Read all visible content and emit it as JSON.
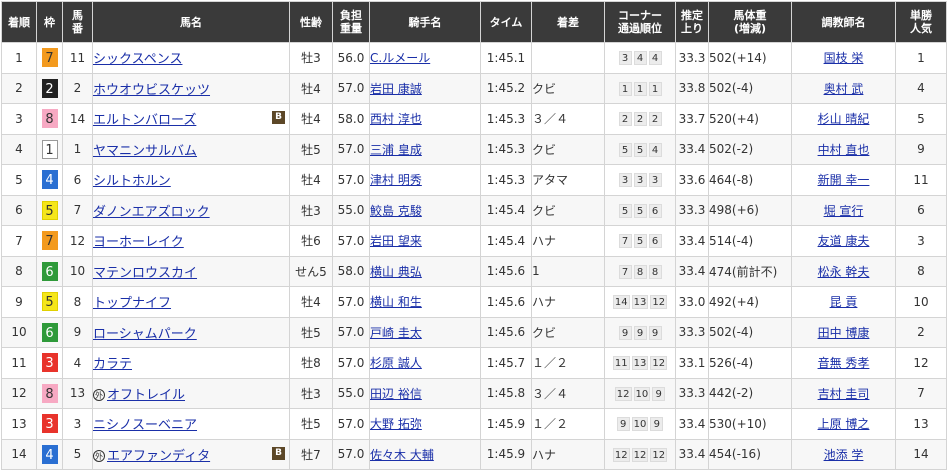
{
  "headers": {
    "rank": "着順",
    "waku": "枠",
    "umaban": "馬\n番",
    "horse": "馬名",
    "sex_age": "性齢",
    "weight_carried": "負担\n重量",
    "jockey": "騎手名",
    "time": "タイム",
    "margin": "着差",
    "corner": "コーナー\n通過順位",
    "last3f": "推定\n上り",
    "body_weight": "馬体重\n(増減)",
    "trainer": "調教師名",
    "popularity": "単勝\n人気"
  },
  "waku_colors": {
    "1": {
      "bg": "#ffffff",
      "fg": "#333333",
      "border": "#999999"
    },
    "2": {
      "bg": "#222222",
      "fg": "#ffffff",
      "border": "#222222"
    },
    "3": {
      "bg": "#e8332b",
      "fg": "#ffffff",
      "border": "#e8332b"
    },
    "4": {
      "bg": "#2a6fd2",
      "fg": "#ffffff",
      "border": "#2a6fd2"
    },
    "5": {
      "bg": "#f5e61a",
      "fg": "#333333",
      "border": "#e0d000"
    },
    "6": {
      "bg": "#2f9a3a",
      "fg": "#ffffff",
      "border": "#2f9a3a"
    },
    "7": {
      "bg": "#f39a1e",
      "fg": "#333333",
      "border": "#f39a1e"
    },
    "8": {
      "bg": "#f7a9c3",
      "fg": "#333333",
      "border": "#f7a9c3"
    }
  },
  "rows": [
    {
      "rank": "1",
      "waku": "7",
      "umaban": "11",
      "horse": "シックスペンス",
      "gai": false,
      "blinker": false,
      "sex_age": "牡3",
      "weight": "56.0",
      "jockey": "C.ルメール",
      "time": "1:45.1",
      "margin": "",
      "corner": [
        "3",
        "4",
        "4"
      ],
      "last3f": "33.3",
      "body": "502",
      "diff": "(+14)",
      "trainer": "国枝 栄",
      "pop": "1"
    },
    {
      "rank": "2",
      "waku": "2",
      "umaban": "2",
      "horse": "ホウオウビスケッツ",
      "gai": false,
      "blinker": false,
      "sex_age": "牡4",
      "weight": "57.0",
      "jockey": "岩田 康誠",
      "time": "1:45.2",
      "margin": "クビ",
      "corner": [
        "1",
        "1",
        "1"
      ],
      "last3f": "33.8",
      "body": "502",
      "diff": "(-4)",
      "trainer": "奥村 武",
      "pop": "4"
    },
    {
      "rank": "3",
      "waku": "8",
      "umaban": "14",
      "horse": "エルトンバローズ",
      "gai": false,
      "blinker": true,
      "sex_age": "牡4",
      "weight": "58.0",
      "jockey": "西村 淳也",
      "time": "1:45.3",
      "margin": "３／４",
      "corner": [
        "2",
        "2",
        "2"
      ],
      "last3f": "33.7",
      "body": "520",
      "diff": "(+4)",
      "trainer": "杉山 晴紀",
      "pop": "5"
    },
    {
      "rank": "4",
      "waku": "1",
      "umaban": "1",
      "horse": "ヤマニンサルバム",
      "gai": false,
      "blinker": false,
      "sex_age": "牡5",
      "weight": "57.0",
      "jockey": "三浦 皇成",
      "time": "1:45.3",
      "margin": "クビ",
      "corner": [
        "5",
        "5",
        "4"
      ],
      "last3f": "33.4",
      "body": "502",
      "diff": "(-2)",
      "trainer": "中村 直也",
      "pop": "9"
    },
    {
      "rank": "5",
      "waku": "4",
      "umaban": "6",
      "horse": "シルトホルン",
      "gai": false,
      "blinker": false,
      "sex_age": "牡4",
      "weight": "57.0",
      "jockey": "津村 明秀",
      "time": "1:45.3",
      "margin": "アタマ",
      "corner": [
        "3",
        "3",
        "3"
      ],
      "last3f": "33.6",
      "body": "464",
      "diff": "(-8)",
      "trainer": "新開 幸一",
      "pop": "11"
    },
    {
      "rank": "6",
      "waku": "5",
      "umaban": "7",
      "horse": "ダノンエアズロック",
      "gai": false,
      "blinker": false,
      "sex_age": "牡3",
      "weight": "55.0",
      "jockey": "鮫島 克駿",
      "time": "1:45.4",
      "margin": "クビ",
      "corner": [
        "5",
        "5",
        "6"
      ],
      "last3f": "33.3",
      "body": "498",
      "diff": "(+6)",
      "trainer": "堀 宣行",
      "pop": "6"
    },
    {
      "rank": "7",
      "waku": "7",
      "umaban": "12",
      "horse": "ヨーホーレイク",
      "gai": false,
      "blinker": false,
      "sex_age": "牡6",
      "weight": "57.0",
      "jockey": "岩田 望来",
      "time": "1:45.4",
      "margin": "ハナ",
      "corner": [
        "7",
        "5",
        "6"
      ],
      "last3f": "33.4",
      "body": "514",
      "diff": "(-4)",
      "trainer": "友道 康夫",
      "pop": "3"
    },
    {
      "rank": "8",
      "waku": "6",
      "umaban": "10",
      "horse": "マテンロウスカイ",
      "gai": false,
      "blinker": false,
      "sex_age": "せん5",
      "weight": "58.0",
      "jockey": "横山 典弘",
      "time": "1:45.6",
      "margin": "1",
      "corner": [
        "7",
        "8",
        "8"
      ],
      "last3f": "33.4",
      "body": "474",
      "diff": "(前計不)",
      "trainer": "松永 幹夫",
      "pop": "8"
    },
    {
      "rank": "9",
      "waku": "5",
      "umaban": "8",
      "horse": "トップナイフ",
      "gai": false,
      "blinker": false,
      "sex_age": "牡4",
      "weight": "57.0",
      "jockey": "横山 和生",
      "time": "1:45.6",
      "margin": "ハナ",
      "corner": [
        "14",
        "13",
        "12"
      ],
      "last3f": "33.0",
      "body": "492",
      "diff": "(+4)",
      "trainer": "昆 貢",
      "pop": "10"
    },
    {
      "rank": "10",
      "waku": "6",
      "umaban": "9",
      "horse": "ローシャムパーク",
      "gai": false,
      "blinker": false,
      "sex_age": "牡5",
      "weight": "57.0",
      "jockey": "戸崎 圭太",
      "time": "1:45.6",
      "margin": "クビ",
      "corner": [
        "9",
        "9",
        "9"
      ],
      "last3f": "33.3",
      "body": "502",
      "diff": "(-4)",
      "trainer": "田中 博康",
      "pop": "2"
    },
    {
      "rank": "11",
      "waku": "3",
      "umaban": "4",
      "horse": "カラテ",
      "gai": false,
      "blinker": false,
      "sex_age": "牡8",
      "weight": "57.0",
      "jockey": "杉原 誠人",
      "time": "1:45.7",
      "margin": "１／２",
      "corner": [
        "11",
        "13",
        "12"
      ],
      "last3f": "33.1",
      "body": "526",
      "diff": "(-4)",
      "trainer": "音無 秀孝",
      "pop": "12"
    },
    {
      "rank": "12",
      "waku": "8",
      "umaban": "13",
      "horse": "オフトレイル",
      "gai": true,
      "blinker": false,
      "sex_age": "牡3",
      "weight": "55.0",
      "jockey": "田辺 裕信",
      "time": "1:45.8",
      "margin": "３／４",
      "corner": [
        "12",
        "10",
        "9"
      ],
      "last3f": "33.3",
      "body": "442",
      "diff": "(-2)",
      "trainer": "吉村 圭司",
      "pop": "7"
    },
    {
      "rank": "13",
      "waku": "3",
      "umaban": "3",
      "horse": "ニシノスーベニア",
      "gai": false,
      "blinker": false,
      "sex_age": "牡5",
      "weight": "57.0",
      "jockey": "大野 拓弥",
      "time": "1:45.9",
      "margin": "１／２",
      "corner": [
        "9",
        "10",
        "9"
      ],
      "last3f": "33.4",
      "body": "530",
      "diff": "(+10)",
      "trainer": "上原 博之",
      "pop": "13"
    },
    {
      "rank": "14",
      "waku": "4",
      "umaban": "5",
      "horse": "エアファンディタ",
      "gai": true,
      "blinker": true,
      "sex_age": "牡7",
      "weight": "57.0",
      "jockey": "佐々木 大輔",
      "time": "1:45.9",
      "margin": "ハナ",
      "corner": [
        "12",
        "12",
        "12"
      ],
      "last3f": "33.4",
      "body": "454",
      "diff": "(-16)",
      "trainer": "池添 学",
      "pop": "14"
    }
  ],
  "labels": {
    "gai": "外",
    "blinker": "B"
  }
}
